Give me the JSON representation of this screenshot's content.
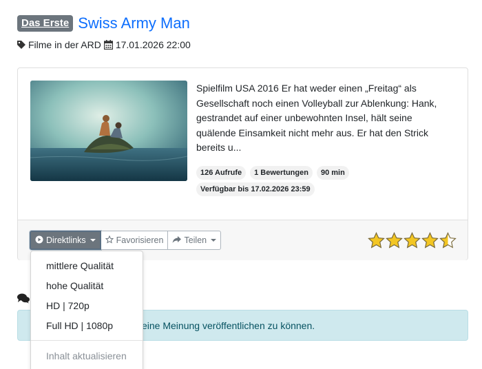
{
  "header": {
    "channel": "Das Erste",
    "title": "Swiss Army Man"
  },
  "meta": {
    "category": "Filme in der ARD",
    "datetime": "17.01.2026 22:00",
    "category_icon": "tag-icon",
    "date_icon": "calendar-icon"
  },
  "card": {
    "description": "Spielfilm USA 2016 Er hat weder einen „Freitag“ als Gesellschaft noch einen Volleyball zur Ablenkung: Hank, gestrandet auf einer unbewohnten Insel, hält seine quälende Einsamkeit nicht mehr aus. Er hat den Strick bereits u...",
    "views": "126 Aufrufe",
    "ratings_count": "1 Bewertungen",
    "duration": "90 min",
    "available_until": "Verfügbar bis 17.02.2026 23:59"
  },
  "footer": {
    "direktlinks_label": "Direktlinks",
    "favorite_label": "Favorisieren",
    "share_label": "Teilen",
    "rating_stars": 4.5,
    "max_stars": 5,
    "star_color": "#f3c623"
  },
  "dropdown": {
    "items": [
      "mittlere Qualität",
      "hohe Qualität",
      "HD | 720p",
      "Full HD | 1080p"
    ],
    "refresh_label": "Inhalt aktualisieren"
  },
  "alert": {
    "text": "eine Meinung veröffentlichen zu können."
  },
  "colors": {
    "accent": "#0d6efd",
    "badge_bg": "#6c757d",
    "alert_bg": "#cfe9ee"
  }
}
